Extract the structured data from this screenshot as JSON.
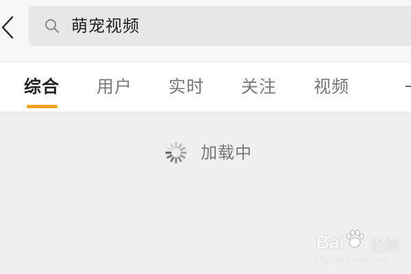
{
  "search": {
    "query": "萌宠视频"
  },
  "tabs": [
    {
      "label": "综合",
      "active": true
    },
    {
      "label": "用户",
      "active": false
    },
    {
      "label": "实时",
      "active": false
    },
    {
      "label": "关注",
      "active": false
    },
    {
      "label": "视频",
      "active": false
    }
  ],
  "loading": {
    "text": "加载中"
  },
  "watermark": {
    "brand": "Bai",
    "suffix": "经验",
    "url": "jingyan.baidu.com"
  },
  "colors": {
    "accent": "#f0a017",
    "background": "#efefef",
    "tab_bar": "#ffffff",
    "search_box": "#e7e7e7"
  },
  "icons": [
    "back-arrow-icon",
    "search-icon",
    "more-tabs-icon",
    "loading-spinner-icon",
    "baidu-paw-icon"
  ]
}
